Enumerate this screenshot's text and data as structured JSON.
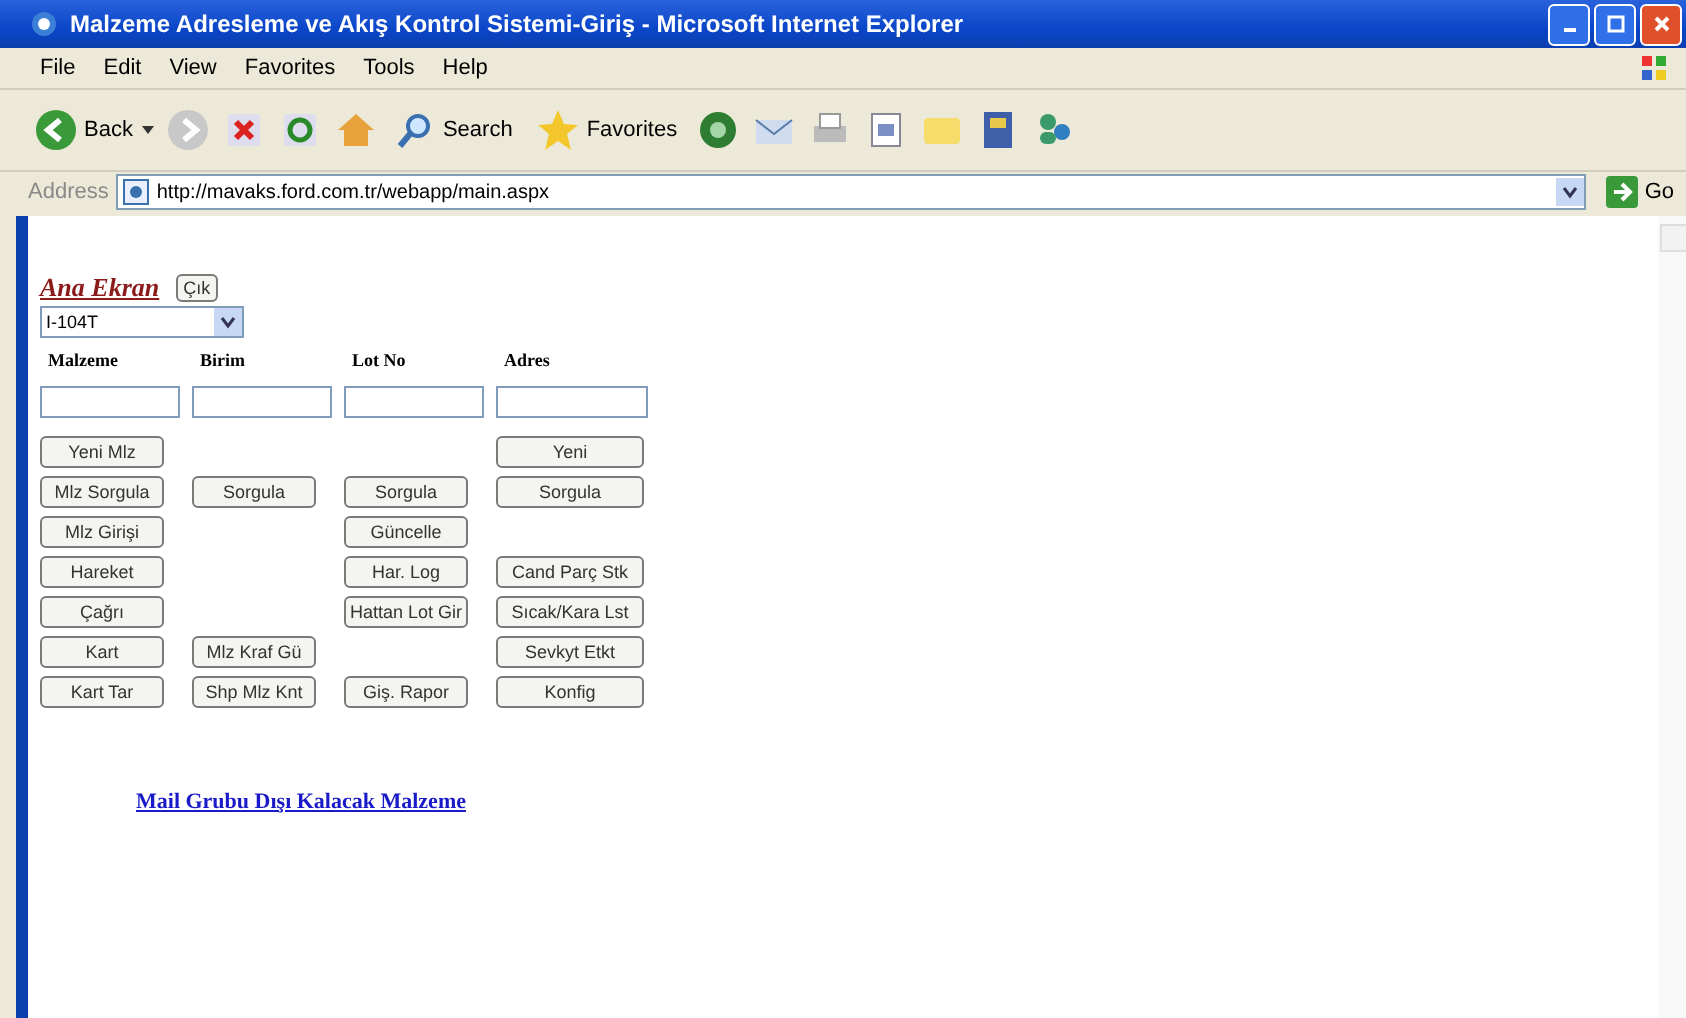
{
  "window": {
    "title": "Malzeme Adresleme ve Akış Kontrol Sistemi-Giriş - Microsoft Internet Explorer"
  },
  "menu": [
    "File",
    "Edit",
    "View",
    "Favorites",
    "Tools",
    "Help"
  ],
  "toolbar": {
    "back": "Back",
    "search": "Search",
    "favorites": "Favorites"
  },
  "address": {
    "label": "Address",
    "value": "http://mavaks.ford.com.tr/webapp/main.aspx",
    "go": "Go"
  },
  "page": {
    "title": "Ana Ekran",
    "exit": "Çık",
    "plant": "I-104T",
    "columns": [
      "Malzeme",
      "Birim",
      "Lot No",
      "Adres"
    ],
    "button_rows": [
      [
        "Yeni Mlz",
        null,
        null,
        "Yeni"
      ],
      [
        "Mlz Sorgula",
        "Sorgula",
        "Sorgula",
        "Sorgula"
      ],
      [
        "Mlz Girişi",
        null,
        "Güncelle",
        null
      ],
      [
        "Hareket",
        null,
        "Har. Log",
        "Cand Parç Stk"
      ],
      [
        "Çağrı",
        null,
        "Hattan Lot Gir",
        "Sıcak/Kara Lst"
      ],
      [
        "Kart",
        "Mlz Kraf Gü",
        null,
        "Sevkyt Etkt"
      ],
      [
        "Kart Tar",
        "Shp Mlz Knt",
        "Giş. Rapor",
        "Konfig"
      ]
    ],
    "link": "Mail Grubu Dışı Kalacak Malzeme"
  }
}
